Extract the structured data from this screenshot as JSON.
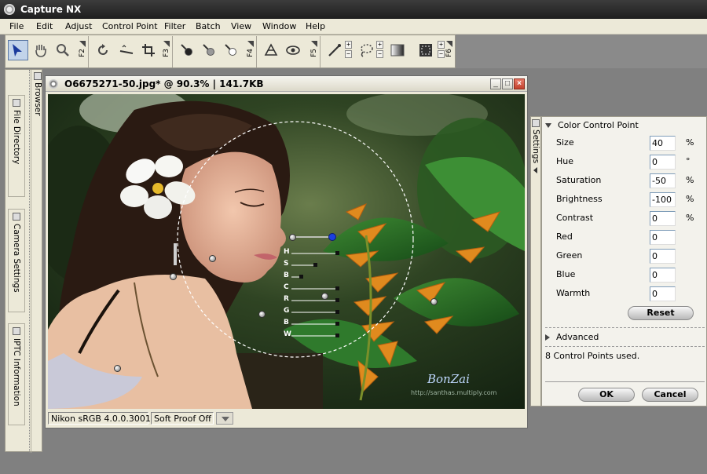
{
  "app": {
    "title": "Capture NX"
  },
  "menu": [
    "File",
    "Edit",
    "Adjust",
    "Control Point",
    "Filter",
    "Batch",
    "View",
    "Window",
    "Help"
  ],
  "toolbar": {
    "fkeys": [
      "F2",
      "F3",
      "F4",
      "F5",
      "F6"
    ],
    "icons": [
      "direct-select-icon",
      "hand-icon",
      "zoom-icon",
      "rotate-icon",
      "straighten-icon",
      "crop-icon",
      "black-control-point-icon",
      "neutral-control-point-icon",
      "white-control-point-icon",
      "red-eye-icon",
      "color-control-point-icon",
      "lasso-icon",
      "gradient-icon",
      "selection-brush-icon"
    ]
  },
  "left_dock": {
    "tabs": [
      "File Directory",
      "Camera Settings",
      "IPTC Information"
    ],
    "browser_label": "Browser"
  },
  "image_window": {
    "title": "O6675271-50.jpg* @ 90.3% | 141.7KB",
    "status_profile": "Nikon sRGB 4.0.0.3001",
    "status_softproof": "Soft Proof Off",
    "watermark_name": "BonZai",
    "watermark_url": "http://santhas.multiply.com",
    "slider_labels": [
      "H",
      "S",
      "B",
      "C",
      "R",
      "G",
      "B",
      "W"
    ]
  },
  "right_dock": {
    "tab_label": "Settings",
    "section_title": "Color Control Point",
    "rows": [
      {
        "label": "Size",
        "value": "40",
        "unit": "%"
      },
      {
        "label": "Hue",
        "value": "0",
        "unit": "°"
      },
      {
        "label": "Saturation",
        "value": "-50",
        "unit": "%"
      },
      {
        "label": "Brightness",
        "value": "-100",
        "unit": "%"
      },
      {
        "label": "Contrast",
        "value": "0",
        "unit": "%"
      },
      {
        "label": "Red",
        "value": "0",
        "unit": ""
      },
      {
        "label": "Green",
        "value": "0",
        "unit": ""
      },
      {
        "label": "Blue",
        "value": "0",
        "unit": ""
      },
      {
        "label": "Warmth",
        "value": "0",
        "unit": ""
      }
    ],
    "reset_label": "Reset",
    "advanced_label": "Advanced",
    "status_text": "8 Control Points used.",
    "ok_label": "OK",
    "cancel_label": "Cancel"
  },
  "colors": {
    "title_bar": "#2a2a2a",
    "chrome": "#ece9d8",
    "workspace": "#808080",
    "close_button": "#c2412c",
    "active_point": "#1b3fe0"
  }
}
